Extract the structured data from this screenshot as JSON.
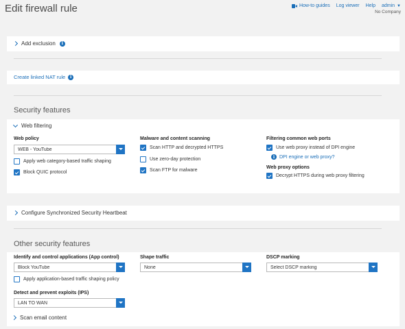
{
  "page": {
    "title": "Edit firewall rule"
  },
  "topnav": {
    "howto": "How-to guides",
    "log_viewer": "Log viewer",
    "help": "Help",
    "admin": "admin",
    "company": "No Company"
  },
  "exclusion": {
    "label": "Add exclusion"
  },
  "nat": {
    "label": "Create linked NAT rule"
  },
  "security": {
    "heading": "Security features",
    "web_filtering": "Web filtering",
    "web_policy": {
      "label": "Web policy",
      "value": "WEB - YouTube",
      "apply_shaping": "Apply web category-based traffic shaping",
      "apply_shaping_checked": false,
      "block_quic": "Block QUIC protocol",
      "block_quic_checked": true
    },
    "malware": {
      "label": "Malware and content scanning",
      "scan_http": "Scan HTTP and decrypted HTTPS",
      "scan_http_checked": true,
      "zero_day": "Use zero-day protection",
      "zero_day_checked": false,
      "scan_ftp": "Scan FTP for malware",
      "scan_ftp_checked": true
    },
    "ports": {
      "label": "Filtering common web ports",
      "use_proxy": "Use web proxy instead of DPI engine",
      "use_proxy_checked": true,
      "dpi_link": "DPI engine or web proxy?",
      "proxy_options_label": "Web proxy options",
      "decrypt": "Decrypt HTTPS during web proxy filtering",
      "decrypt_checked": true
    }
  },
  "heartbeat": {
    "label": "Configure Synchronized Security Heartbeat"
  },
  "other": {
    "heading": "Other security features",
    "app_control": {
      "label": "Identify and control applications (App control)",
      "value": "Block YouTube",
      "apply_shaping": "Apply application-based traffic shaping policy",
      "apply_shaping_checked": false
    },
    "shape": {
      "label": "Shape traffic",
      "value": "None"
    },
    "dscp": {
      "label": "DSCP marking",
      "value": "Select DSCP marking"
    },
    "ips": {
      "label": "Detect and prevent exploits (IPS)",
      "value": "LAN TO WAN"
    },
    "scan_email": "Scan email content"
  }
}
